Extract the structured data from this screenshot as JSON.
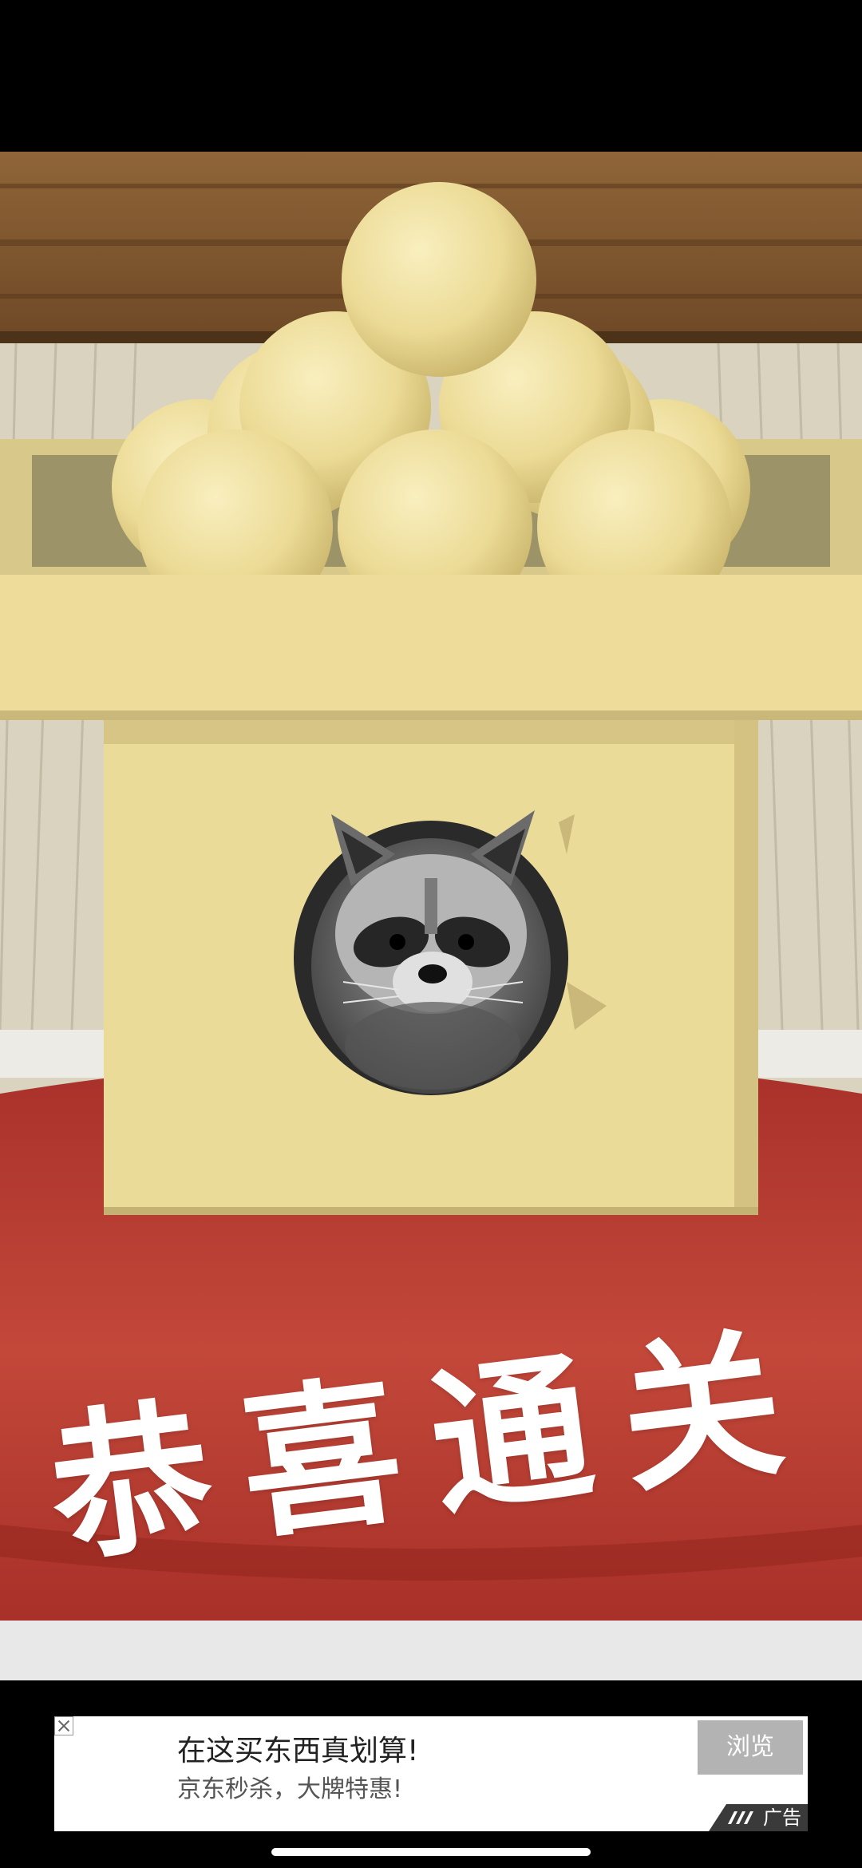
{
  "game": {
    "banner_text": "恭喜通关",
    "character_icon": "raccoon-icon"
  },
  "ad": {
    "title": "在这买东西真划算!",
    "subtitle": "京东秒杀，大牌特惠!",
    "button_label": "浏览",
    "badge_label": "广告",
    "close_icon": "close-icon"
  },
  "colors": {
    "background": "#000000",
    "dumpling": "#eee0a0",
    "stand": "#ecdc98",
    "cushion": "#b73a2e",
    "floor": "#d8d2bc",
    "wood": "#8a5a30"
  }
}
